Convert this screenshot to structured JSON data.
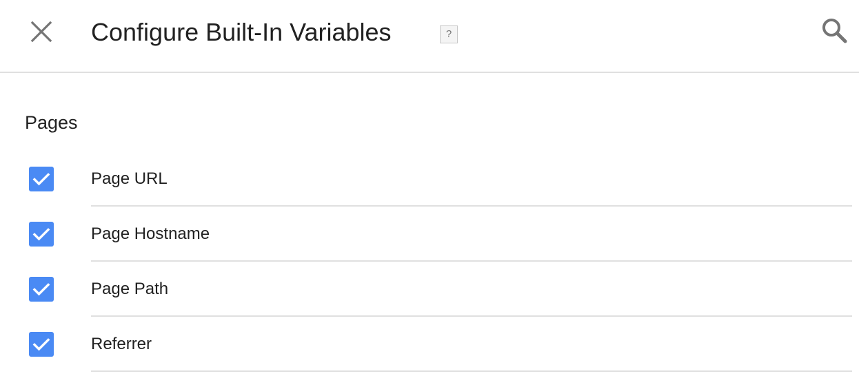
{
  "header": {
    "title": "Configure Built-In Variables",
    "help_label": "?",
    "close_icon": "close-icon",
    "search_icon": "search-icon"
  },
  "section": {
    "title": "Pages"
  },
  "variables": [
    {
      "label": "Page URL",
      "checked": true
    },
    {
      "label": "Page Hostname",
      "checked": true
    },
    {
      "label": "Page Path",
      "checked": true
    },
    {
      "label": "Referrer",
      "checked": true
    }
  ],
  "colors": {
    "checkbox": "#4a8af4",
    "divider": "#e0e0e0",
    "icon": "#757575",
    "text": "#212121"
  }
}
